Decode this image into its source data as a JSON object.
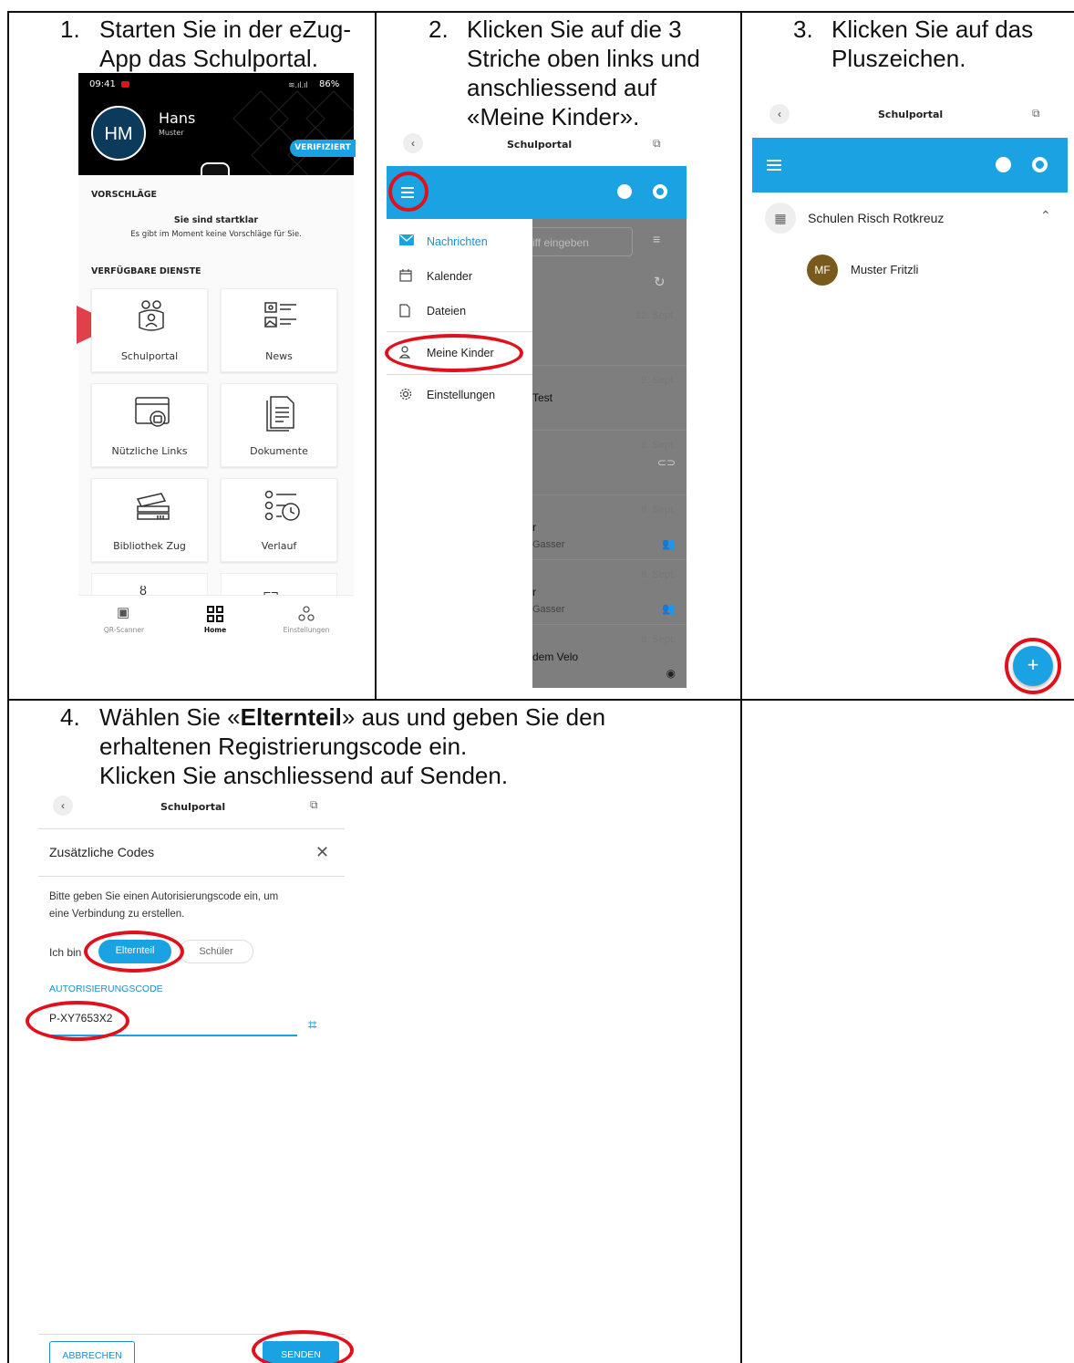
{
  "steps": {
    "s1": {
      "num": "1.",
      "line1": "Starten Sie in der eZug-",
      "line2": "App das Schulportal."
    },
    "s2": {
      "num": "2.",
      "line1": "Klicken Sie auf die 3",
      "line2": "Striche oben links und",
      "line3": "anschliessend auf",
      "line4": "«Meine Kinder»."
    },
    "s3": {
      "num": "3.",
      "line1": "Klicken Sie auf das",
      "line2": "Pluszeichen."
    },
    "s4": {
      "num": "4.",
      "line1_a": "Wählen Sie «",
      "line1_bold": "Elternteil",
      "line1_b": "» aus und geben Sie den",
      "line2": "erhaltenen Registrierungscode ein.",
      "line3": "Klicken Sie anschliessend auf Senden."
    }
  },
  "phone1": {
    "time": "09:41",
    "battery": "86%",
    "avatar_initials": "HM",
    "user_name": "Hans",
    "user_sub": "Muster",
    "verified_badge": "VERIFIZIERT",
    "suggestions_title": "VORSCHLÄGE",
    "suggestions_head": "Sie sind startklar",
    "suggestions_text": "Es gibt im Moment keine Vorschläge für Sie.",
    "services_title": "VERFÜGBARE DIENSTE",
    "tiles": [
      "Schulportal",
      "News",
      "Nützliche Links",
      "Dokumente",
      "Bibliothek Zug",
      "Verlauf"
    ],
    "nav": [
      "QR-Scanner",
      "Home",
      "Einstellungen"
    ]
  },
  "phone2": {
    "title": "Schulportal",
    "menu": [
      "Nachrichten",
      "Kalender",
      "Dateien",
      "Meine Kinder",
      "Einstellungen"
    ],
    "search_placeholder": "iff eingeben",
    "dates": [
      "12. Sept.",
      "9. Sept.",
      "8. Sept.",
      "8. Sept.",
      "8. Sept.",
      "8. Sept."
    ],
    "fragments": [
      "Test",
      "r",
      "Gasser",
      "r",
      "Gasser",
      "dem Velo"
    ],
    "accent_color": "#1ba2e3"
  },
  "phone3": {
    "title": "Schulportal",
    "school": "Schulen Risch Rotkreuz",
    "child_initials": "MF",
    "child_name": "Muster Fritzli",
    "fab": "+"
  },
  "phone4": {
    "title": "Schulportal",
    "dialog_title": "Zusätzliche Codes",
    "desc_line1": "Bitte geben Sie einen Autorisierungscode ein, um",
    "desc_line2": "eine Verbindung zu erstellen.",
    "role_label": "Ich bin",
    "role_parent": "Elternteil",
    "role_student": "Schüler",
    "code_label": "AUTORISIERUNGSCODE",
    "code_value": "P-XY7653X2",
    "cancel": "ABBRECHEN",
    "send": "SENDEN"
  }
}
